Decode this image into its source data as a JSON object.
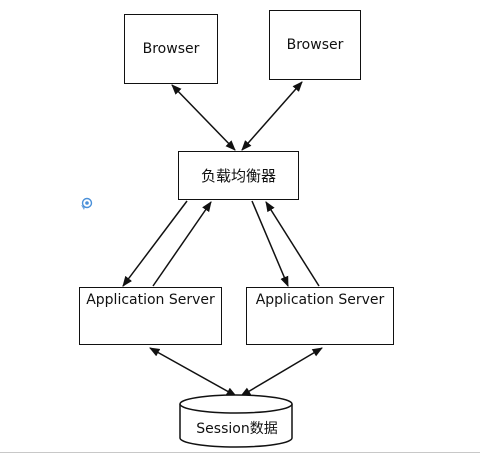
{
  "nodes": {
    "browser_left": "Browser",
    "browser_right": "Browser",
    "load_balancer": "负载均衡器",
    "app_server_left": "Application Server",
    "app_server_right": "Application Server",
    "session_store": "Session数据"
  },
  "colors": {
    "line": "#111111",
    "background": "#ffffff",
    "icon": "#4a90d9"
  },
  "icons": {
    "stray": "cursor-badge-icon"
  }
}
